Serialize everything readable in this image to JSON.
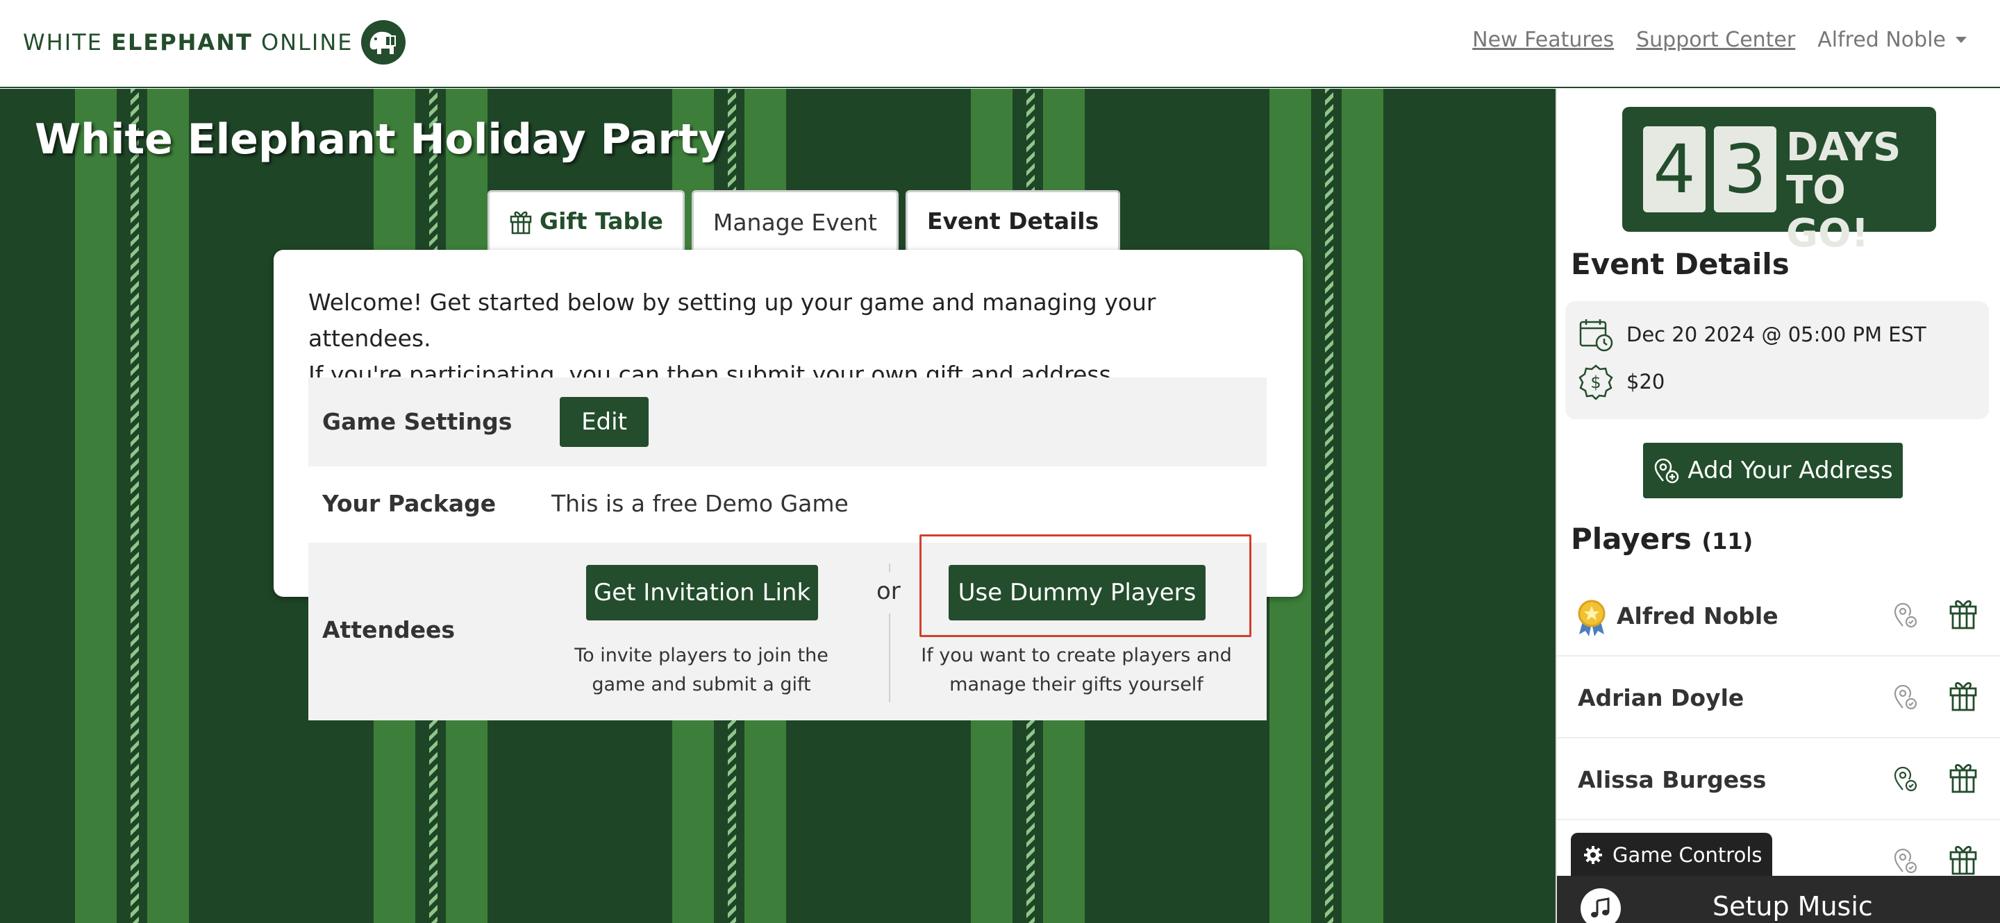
{
  "header": {
    "logo_words": [
      "WHITE",
      "ELEPHANT",
      "ONLINE"
    ],
    "nav": {
      "new_features": "New Features",
      "support_center": "Support Center",
      "user_name": "Alfred Noble"
    }
  },
  "event": {
    "title": "White Elephant Holiday Party"
  },
  "tabs": [
    {
      "label": "Gift Table"
    },
    {
      "label": "Manage Event"
    },
    {
      "label": "Event Details"
    }
  ],
  "manage": {
    "welcome_line1": "Welcome! Get started below by setting up your game and managing your attendees.",
    "welcome_line2": "If you're participating, you can then submit your own gift and address.",
    "game_settings_label": "Game Settings",
    "edit_label": "Edit",
    "package_label": "Your Package",
    "package_value": "This is a free Demo Game",
    "attendees_label": "Attendees",
    "invite_button": "Get Invitation Link",
    "invite_help": "To invite players to join the game and submit a gift",
    "or_text": "or",
    "dummy_button": "Use Dummy Players",
    "dummy_help": "If you want to create players and manage their gifts yourself"
  },
  "sidebar": {
    "countdown": {
      "digit1": "4",
      "digit2": "3",
      "line1": "DAYS",
      "line2": "TO GO!"
    },
    "event_details_heading": "Event Details",
    "date_text": "Dec 20 2024 @ 05:00 PM EST",
    "price_text": "$20",
    "add_address_label": "Add Your Address",
    "players_heading": "Players",
    "players_count": "(11)",
    "players": [
      {
        "name": "Alfred Noble"
      },
      {
        "name": "Adrian Doyle"
      },
      {
        "name": "Alissa Burgess"
      },
      {
        "name": ""
      }
    ],
    "game_controls_label": "Game Controls",
    "setup_music_label": "Setup Music"
  },
  "colors": {
    "brand_green": "#234d2c",
    "stripe_light": "#3d7f3a",
    "stripe_dark": "#1f4527",
    "highlight_red": "#d0402e"
  }
}
